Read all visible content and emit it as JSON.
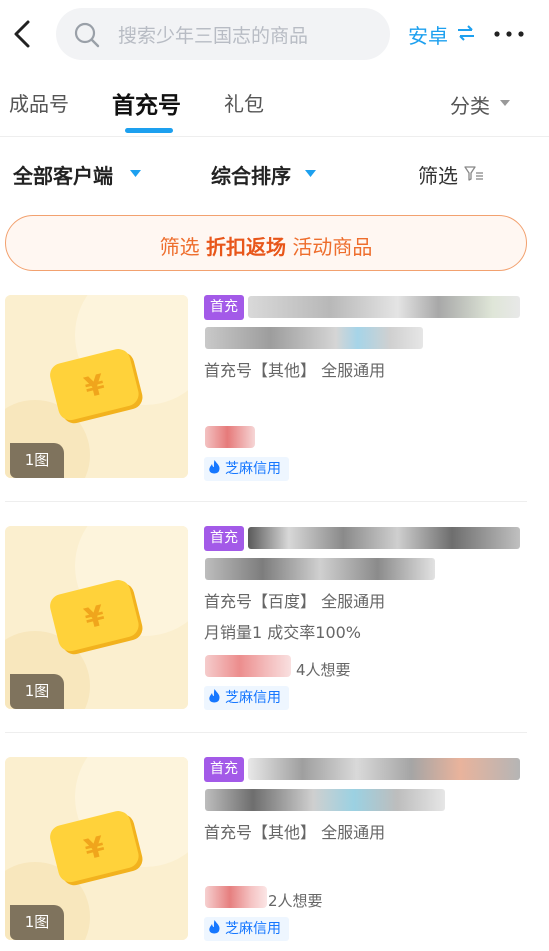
{
  "header": {
    "search_placeholder": "搜索少年三国志的商品",
    "platform_label": "安卓"
  },
  "tabs": [
    {
      "label": "成品号",
      "active": false
    },
    {
      "label": "首充号",
      "active": true
    },
    {
      "label": "礼包",
      "active": false
    }
  ],
  "category_label": "分类",
  "filters": {
    "client_label": "全部客户端",
    "sort_label": "综合排序",
    "filter_label": "筛选"
  },
  "promo": {
    "prefix": "筛选",
    "highlight": "折扣返场",
    "suffix": "活动商品"
  },
  "listings": [
    {
      "badge": "首充",
      "image_count": "1图",
      "desc": "首充号【其他】 全服通用",
      "stats": "",
      "want": "",
      "credit_label": "芝麻信用"
    },
    {
      "badge": "首充",
      "image_count": "1图",
      "desc": "首充号【百度】 全服通用",
      "stats": "月销量1 成交率100%",
      "want": "4人想要",
      "credit_label": "芝麻信用"
    },
    {
      "badge": "首充",
      "image_count": "1图",
      "desc": "首充号【其他】 全服通用",
      "stats": "",
      "want": "2人想要",
      "credit_label": "芝麻信用"
    }
  ],
  "colors": {
    "accent": "#1da0ef",
    "badge": "#a35ae8",
    "promo": "#ee6d2c",
    "credit": "#1677ff"
  }
}
